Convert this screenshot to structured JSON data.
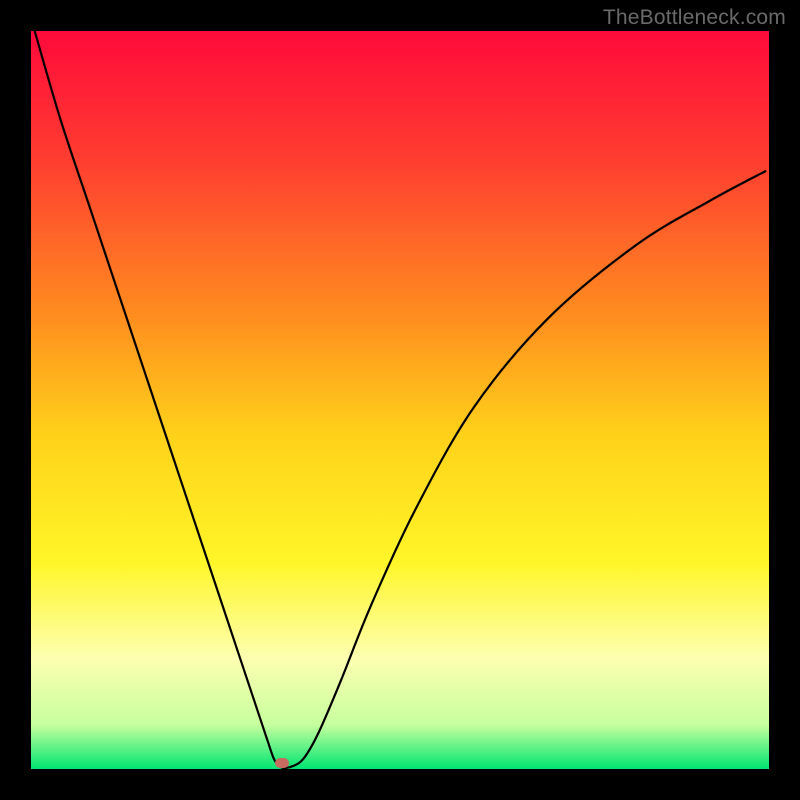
{
  "watermark": "TheBottleneck.com",
  "chart_data": {
    "type": "line",
    "title": "",
    "xlabel": "",
    "ylabel": "",
    "xlim": [
      0,
      100
    ],
    "ylim": [
      0,
      100
    ],
    "gradient_stops": [
      {
        "pos": 0,
        "color": "#ff0a3a"
      },
      {
        "pos": 18,
        "color": "#ff3f30"
      },
      {
        "pos": 38,
        "color": "#ff8b1f"
      },
      {
        "pos": 55,
        "color": "#ffd21a"
      },
      {
        "pos": 72,
        "color": "#fff628"
      },
      {
        "pos": 85,
        "color": "#fdffb0"
      },
      {
        "pos": 94,
        "color": "#c7ff9e"
      },
      {
        "pos": 100,
        "color": "#00e571"
      }
    ],
    "series": [
      {
        "name": "bottleneck-curve",
        "x": [
          0.5,
          4,
          8,
          12,
          16,
          20,
          24,
          28,
          30,
          32,
          33,
          34,
          35.5,
          37,
          39,
          42,
          46,
          52,
          60,
          70,
          82,
          92,
          99.5
        ],
        "y": [
          100,
          88,
          76,
          64,
          52,
          40,
          28,
          16,
          10,
          4,
          1.2,
          0.2,
          0.4,
          1.5,
          5,
          12,
          22,
          35,
          49,
          61,
          71,
          77,
          81
        ]
      }
    ],
    "marker": {
      "x": 34,
      "y": 0.8,
      "color": "#c76a5f"
    },
    "curve_stroke": "#000000",
    "curve_width": 2.2
  }
}
